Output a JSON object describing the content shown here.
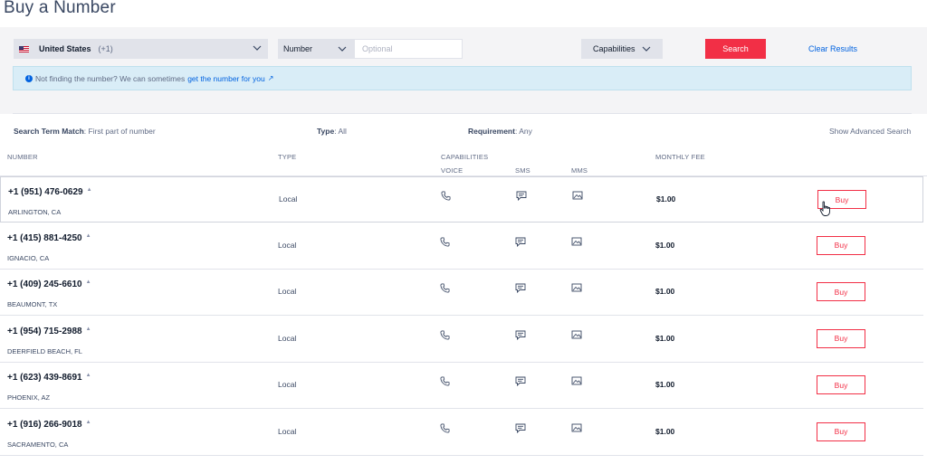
{
  "page": {
    "title": "Buy a Number"
  },
  "filters": {
    "country": "United States",
    "country_code": "(+1)",
    "type_label": "Number",
    "number_placeholder": "Optional",
    "number_value": "",
    "capabilities_label": "Capabilities",
    "search_label": "Search",
    "clear_label": "Clear Results"
  },
  "notice": {
    "text": "Not finding the number? We can sometimes",
    "link": "get the number for you",
    "arrow": "↗"
  },
  "criteria": {
    "match_label": "Search Term Match",
    "match_value": ": First part of number",
    "type_label": "Type",
    "type_value": ": All",
    "requirement_label": "Requirement",
    "requirement_value": ": Any",
    "advanced_label": "Show Advanced Search"
  },
  "table": {
    "headers": {
      "number": "NUMBER",
      "type": "TYPE",
      "capabilities": "CAPABILITIES",
      "voice": "VOICE",
      "sms": "SMS",
      "mms": "MMS",
      "fee": "MONTHLY FEE"
    },
    "buy_label": "Buy",
    "rows": [
      {
        "number": "+1 (951) 476-0629",
        "location": "ARLINGTON, CA",
        "type": "Local",
        "fee": "$1.00"
      },
      {
        "number": "+1 (415) 881-4250",
        "location": "IGNACIO, CA",
        "type": "Local",
        "fee": "$1.00"
      },
      {
        "number": "+1 (409) 245-6610",
        "location": "BEAUMONT, TX",
        "type": "Local",
        "fee": "$1.00"
      },
      {
        "number": "+1 (954) 715-2988",
        "location": "DEERFIELD BEACH, FL",
        "type": "Local",
        "fee": "$1.00"
      },
      {
        "number": "+1 (623) 439-8691",
        "location": "PHOENIX, AZ",
        "type": "Local",
        "fee": "$1.00"
      },
      {
        "number": "+1 (916) 266-9018",
        "location": "SACRAMENTO, CA",
        "type": "Local",
        "fee": "$1.00"
      }
    ]
  },
  "icons": {
    "voice": "phone-icon",
    "sms": "message-icon",
    "mms": "image-icon",
    "chevron": "chevron-down-icon",
    "info": "info-icon"
  },
  "colors": {
    "accent": "#f22f46",
    "link": "#0263e0",
    "notice_bg": "#d9edf7"
  }
}
